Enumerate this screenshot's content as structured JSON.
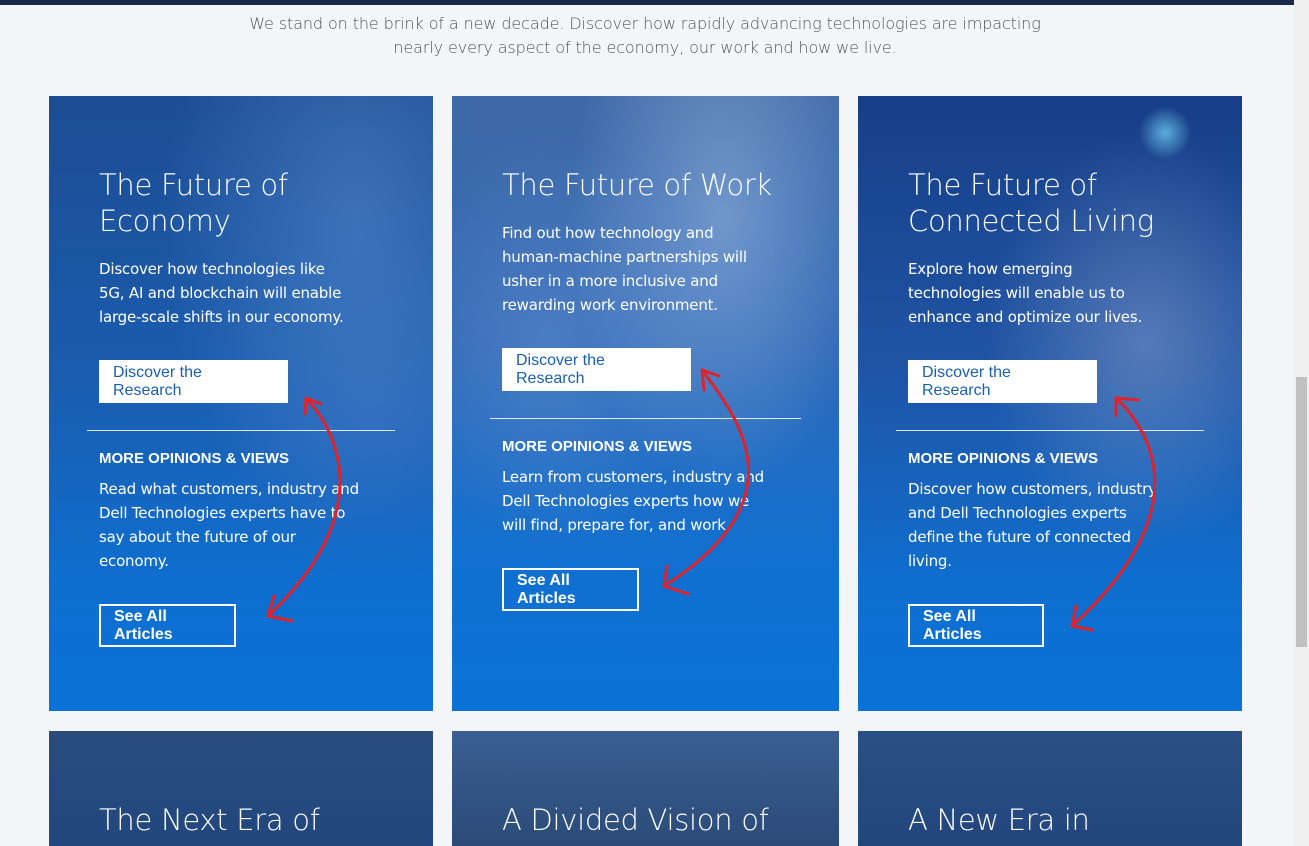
{
  "intro": "We stand on the brink of a new decade. Discover how rapidly advancing technologies are impacting nearly every aspect of the economy, our work and how we live.",
  "cards": [
    {
      "title": "The Future of Economy",
      "description": "Discover how technologies like 5G, AI and blockchain will enable large-scale shifts in our economy.",
      "research_button": "Discover the Research",
      "section_heading": "MORE OPINIONS & VIEWS",
      "section_text": "Read what customers, industry and Dell Technologies experts have to say about the future of our economy.",
      "articles_button": "See All Articles"
    },
    {
      "title": "The Future of Work",
      "description": "Find out how technology and human-machine partnerships will usher in a more inclusive and rewarding work environment.",
      "research_button": "Discover the Research",
      "section_heading": "MORE OPINIONS & VIEWS",
      "section_text": "Learn from customers, industry and Dell Technologies experts how we will find, prepare for, and work.",
      "articles_button": "See All Articles"
    },
    {
      "title": "The Future of Connected Living",
      "description": "Explore how emerging technologies will enable us to enhance and optimize our lives.",
      "research_button": "Discover the Research",
      "section_heading": "MORE OPINIONS & VIEWS",
      "section_text": "Discover how customers, industry and Dell Technologies experts define the future of connected living.",
      "articles_button": "See All Articles"
    }
  ],
  "bottom_cards": [
    {
      "title": "The Next Era of"
    },
    {
      "title": "A Divided Vision of"
    },
    {
      "title": "A New Era in"
    }
  ],
  "colors": {
    "accent_button_text": "#1a5fb0",
    "annotation_arrow": "#e0222a"
  }
}
